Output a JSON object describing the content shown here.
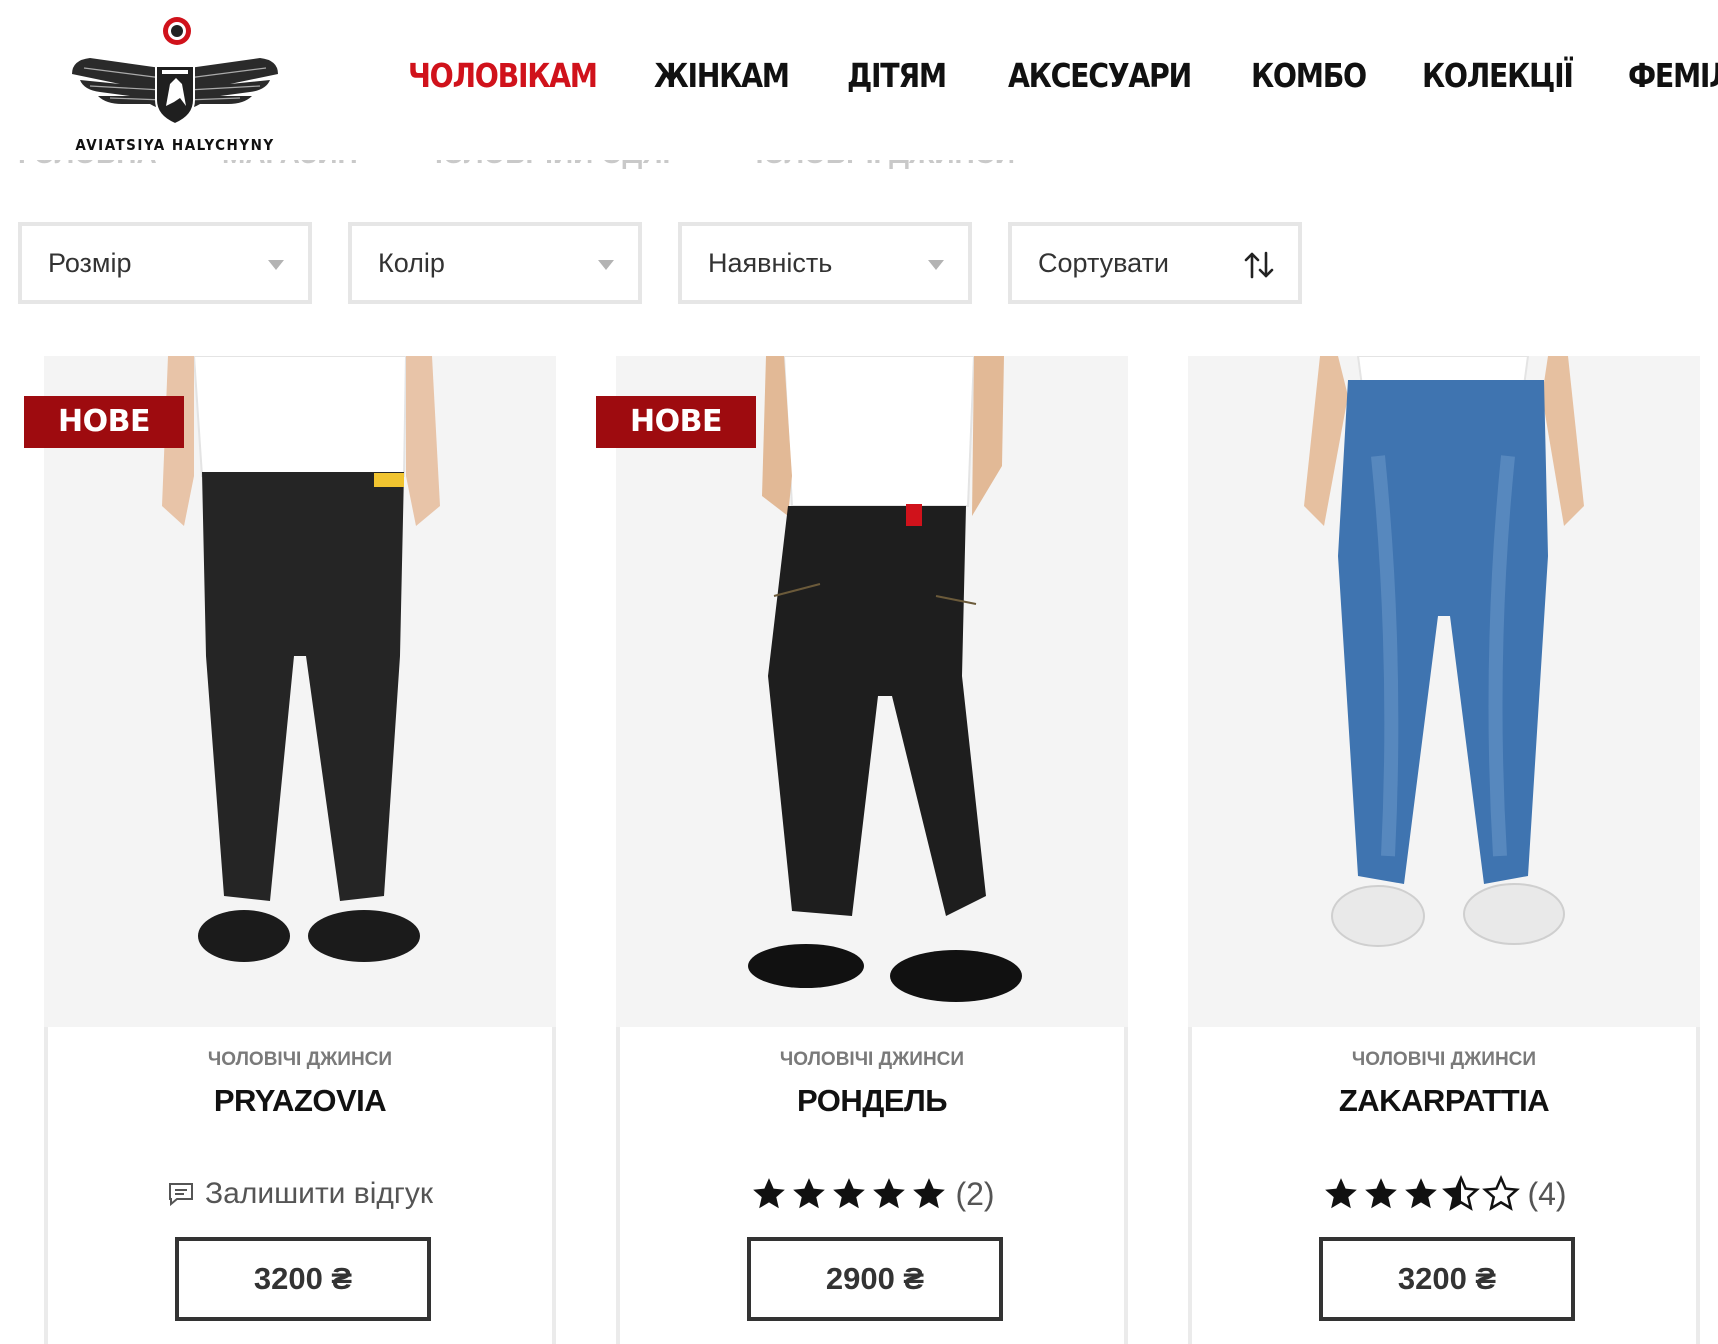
{
  "brand": {
    "name": "AVIATSIYA HALYCHYNY"
  },
  "nav": {
    "items": [
      "ЧОЛОВІКАМ",
      "ЖІНКАМ",
      "ДІТЯМ",
      "АКСЕСУАРИ",
      "КОМБО",
      "КОЛЕКЦІЇ",
      "ФЕМІЛІ"
    ],
    "active_index": 0
  },
  "breadcrumb": [
    "ГОЛОВНА",
    "МАГАЗИН",
    "ЧОЛОВІЧИЙ ОДЯГ",
    "ЧОЛОВІЧІ ДЖИНСИ"
  ],
  "filters": {
    "size": "Розмір",
    "color": "Колір",
    "availability": "Наявність",
    "sort": "Сортувати"
  },
  "colors": {
    "accent": "#d0121b",
    "badge": "#9e0b0f"
  },
  "products": [
    {
      "badge": "НОВЕ",
      "category": "ЧОЛОВІЧІ ДЖИНСИ",
      "title": "PRYAZOVIA",
      "review_link": "Залишити відгук",
      "rating": null,
      "rating_count": "",
      "price": "3200 ₴",
      "jeans_color": "#252525"
    },
    {
      "badge": "НОВЕ",
      "category": "ЧОЛОВІЧІ ДЖИНСИ",
      "title": "РОНДЕЛЬ",
      "review_link": "",
      "rating": 5,
      "rating_count": "(2)",
      "price": "2900 ₴",
      "jeans_color": "#1e1e1e"
    },
    {
      "badge": "",
      "category": "ЧОЛОВІЧІ ДЖИНСИ",
      "title": "ZAKARPATTIA",
      "review_link": "",
      "rating": 3.5,
      "rating_count": "(4)",
      "price": "3200 ₴",
      "jeans_color": "#3f74b0"
    }
  ]
}
